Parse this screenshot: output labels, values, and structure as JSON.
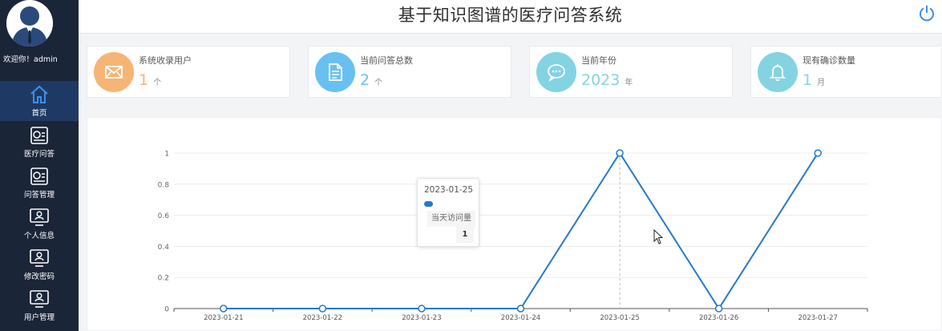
{
  "header": {
    "title": "基于知识图谱的医疗问答系统"
  },
  "sidebar": {
    "welcome": "欢迎你！admin",
    "items": [
      {
        "label": "首页",
        "icon": "home-icon"
      },
      {
        "label": "医疗问答",
        "icon": "document-chart-icon"
      },
      {
        "label": "问答管理",
        "icon": "document-chart-icon"
      },
      {
        "label": "个人信息",
        "icon": "user-monitor-icon"
      },
      {
        "label": "修改密码",
        "icon": "user-monitor-icon"
      },
      {
        "label": "用户管理",
        "icon": "user-monitor-icon"
      }
    ]
  },
  "stats": [
    {
      "label": "系统收录用户",
      "value": "1",
      "unit": "个",
      "color": "#f6b574",
      "icon": "mail-icon"
    },
    {
      "label": "当前问答总数",
      "value": "2",
      "unit": "个",
      "color": "#69c0f0",
      "icon": "document-icon"
    },
    {
      "label": "当前年份",
      "value": "2023",
      "unit": "年",
      "color": "#83d3e2",
      "icon": "chat-icon"
    },
    {
      "label": "现有确诊数量",
      "value": "1",
      "unit": "月",
      "color": "#83d3e2",
      "icon": "bell-icon"
    }
  ],
  "colors": {
    "accent": "#2479cc",
    "sidebar_bg": "#1b2538",
    "sidebar_active": "#1e3a64"
  },
  "tooltip": {
    "date": "2023-01-25",
    "series": "当天访问量",
    "value": "1"
  },
  "chart_data": {
    "type": "line",
    "x": [
      "2023-01-21",
      "2023-01-22",
      "2023-01-23",
      "2023-01-24",
      "2023-01-25",
      "2023-01-26",
      "2023-01-27"
    ],
    "series": [
      {
        "name": "当天访问量",
        "values": [
          0,
          0,
          0,
          0,
          1,
          0,
          1
        ]
      }
    ],
    "yticks": [
      "0",
      "0.2",
      "0.4",
      "0.6",
      "0.8",
      "1"
    ],
    "ylim": [
      0,
      1
    ],
    "grid": true,
    "highlighted_x": "2023-01-25"
  }
}
